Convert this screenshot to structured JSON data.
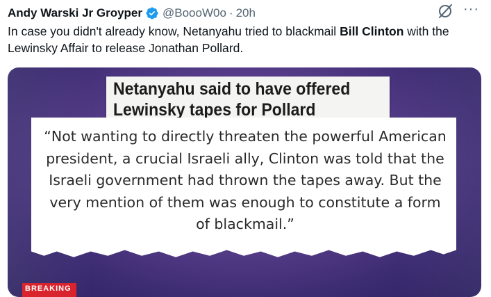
{
  "tweet": {
    "author_name": "Andy Warski Jr Groyper",
    "handle": "@BoooW0o",
    "separator": "·",
    "time": "20h",
    "text_part1": "In case you didn't already know, Netanyahu tried to blackmail ",
    "text_bold": "Bill Clinton",
    "text_part2": " with the Lewinsky Affair to release Jonathan Pollard."
  },
  "icons": {
    "verified": "verified-badge-icon",
    "grok": "grok-icon",
    "more": "more-options-icon"
  },
  "media": {
    "headline": "Netanyahu said to have offered Lewinsky tapes for Pollard",
    "quote": "“Not wanting to directly threaten the powerful American president, a crucial Israeli ally, Clinton was told that the Israeli government had thrown the tapes away. But the very mention of them was enough to constitute a form of blackmail.”",
    "banner": "BREAKING"
  },
  "colors": {
    "verified_blue": "#1d9bf0",
    "secondary_text": "#536471",
    "banner_red": "#d9232d"
  }
}
